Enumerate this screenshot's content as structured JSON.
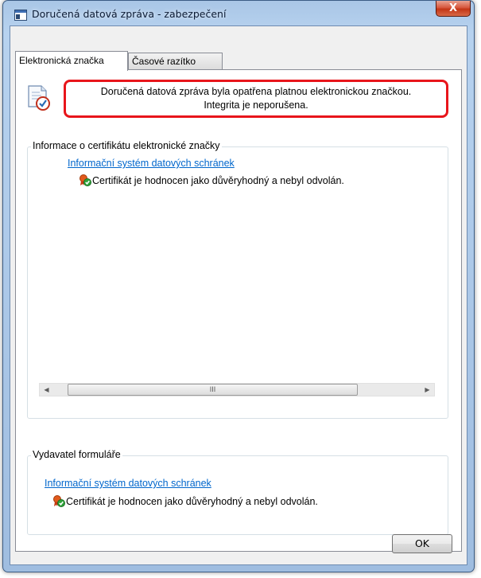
{
  "window": {
    "title": "Doručená datová zpráva - zabezpečení",
    "close_label": "X"
  },
  "tabs": [
    {
      "label": "Elektronická značka",
      "active": true
    },
    {
      "label": "Časové razítko",
      "active": false
    }
  ],
  "status_message": {
    "line1": "Doručená datová zpráva byla opatřena platnou elektronickou značkou.",
    "line2": "Integrita je neporušena."
  },
  "certificate_group": {
    "legend": "Informace o certifikátu elektronické značky",
    "link": "Informační systém datových schránek",
    "status": "Certifikát je hodnocen jako důvěryhodný a nebyl odvolán.",
    "scrollbar_grip": "III"
  },
  "issuer_group": {
    "legend": "Vydavatel formuláře",
    "link": "Informační systém datových schránek",
    "status": "Certifikát je hodnocen jako důvěryhodný a nebyl odvolán."
  },
  "buttons": {
    "ok_label": "OK"
  },
  "colors": {
    "highlight_border": "#e8151b",
    "link": "#0066cc",
    "titlebar": "#b7d2ef"
  }
}
